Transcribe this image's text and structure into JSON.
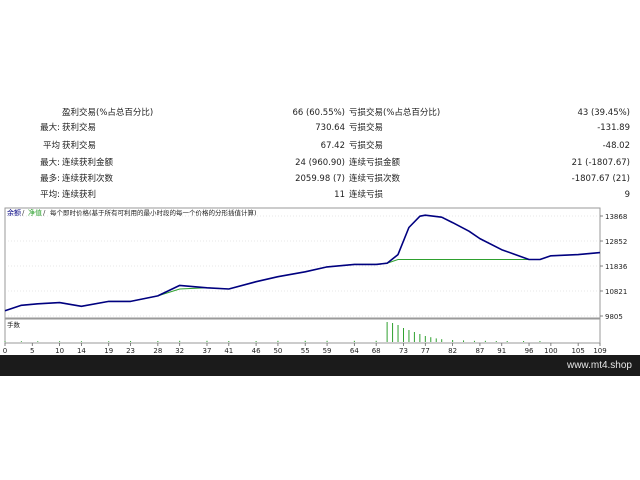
{
  "stats": [
    {
      "label": "",
      "k1": "盈利交易(%占总百分比)",
      "v1": "66 (60.55%)",
      "k2": "亏损交易(%占总百分比)",
      "v2": "43 (39.45%)"
    },
    {
      "label": "最大:",
      "k1": "获利交易",
      "v1": "730.64",
      "k2": "亏损交易",
      "v2": "-131.89"
    },
    {
      "label": "平均",
      "k1": "获利交易",
      "v1": "67.42",
      "k2": "亏损交易",
      "v2": "-48.02"
    },
    {
      "label": "最大:",
      "k1": "连续获利金额",
      "v1": "24 (960.90)",
      "k2": "连续亏损金额",
      "v2": "21 (-1807.67)"
    },
    {
      "label": "最多:",
      "k1": "连续获利次数",
      "v1": "2059.98 (7)",
      "k2": "连续亏损次数",
      "v2": "-1807.67 (21)"
    },
    {
      "label": "平均:",
      "k1": "连续获利",
      "v1": "11",
      "k2": "连续亏损",
      "v2": "9"
    }
  ],
  "chart": {
    "legend": {
      "balance": "余额",
      "equity": "净值",
      "note": "每个即时价格(基于所有可利用的最小时段的每一个价格的分形插值计算)"
    },
    "volume_label": "手数",
    "y_ticks": [
      "13868",
      "12852",
      "11836",
      "10821",
      "9805"
    ],
    "x_ticks": [
      "0",
      "5",
      "10",
      "14",
      "19",
      "23",
      "28",
      "32",
      "37",
      "41",
      "46",
      "50",
      "55",
      "59",
      "64",
      "68",
      "73",
      "77",
      "82",
      "87",
      "91",
      "96",
      "100",
      "105",
      "109"
    ],
    "colors": {
      "balance": "#000080",
      "equity": "#2ea02e",
      "volume": "#2ea02e",
      "grid": "#d0d0d0"
    }
  },
  "chart_data": {
    "type": "line",
    "ylim": [
      9805,
      13868
    ],
    "xlim": [
      0,
      109
    ],
    "series": [
      {
        "name": "余额",
        "x": [
          0,
          3,
          6,
          10,
          14,
          19,
          23,
          28,
          32,
          37,
          41,
          46,
          50,
          55,
          59,
          64,
          68,
          70,
          72,
          74,
          76,
          77,
          80,
          82,
          85,
          87,
          91,
          96,
          98,
          100,
          105,
          109
        ],
        "values": [
          10020,
          10240,
          10300,
          10350,
          10200,
          10400,
          10400,
          10620,
          11050,
          10950,
          10900,
          11200,
          11400,
          11600,
          11800,
          11900,
          11900,
          11950,
          12300,
          13400,
          13860,
          13900,
          13820,
          13600,
          13250,
          12950,
          12500,
          12100,
          12100,
          12250,
          12300,
          12380
        ]
      },
      {
        "name": "净值",
        "x": [
          0,
          3,
          6,
          10,
          14,
          19,
          23,
          28,
          32,
          37,
          41,
          46,
          50,
          55,
          59,
          64,
          68,
          70,
          72,
          98,
          100,
          105,
          109
        ],
        "values": [
          10020,
          10240,
          10300,
          10350,
          10200,
          10400,
          10400,
          10620,
          10900,
          10950,
          10900,
          11200,
          11400,
          11600,
          11800,
          11900,
          11900,
          11950,
          12100,
          12100,
          12250,
          12300,
          12380
        ]
      }
    ]
  },
  "volume_bars": [
    {
      "x": 0,
      "v": 0.04
    },
    {
      "x": 3,
      "v": 0.04
    },
    {
      "x": 6,
      "v": 0.04
    },
    {
      "x": 10,
      "v": 0.04
    },
    {
      "x": 14,
      "v": 0.04
    },
    {
      "x": 19,
      "v": 0.04
    },
    {
      "x": 23,
      "v": 0.05
    },
    {
      "x": 28,
      "v": 0.05
    },
    {
      "x": 32,
      "v": 0.06
    },
    {
      "x": 37,
      "v": 0.06
    },
    {
      "x": 41,
      "v": 0.05
    },
    {
      "x": 46,
      "v": 0.05
    },
    {
      "x": 50,
      "v": 0.06
    },
    {
      "x": 55,
      "v": 0.06
    },
    {
      "x": 59,
      "v": 0.06
    },
    {
      "x": 64,
      "v": 0.06
    },
    {
      "x": 68,
      "v": 0.06
    },
    {
      "x": 70,
      "v": 1.0
    },
    {
      "x": 71,
      "v": 0.95
    },
    {
      "x": 72,
      "v": 0.85
    },
    {
      "x": 73,
      "v": 0.7
    },
    {
      "x": 74,
      "v": 0.6
    },
    {
      "x": 75,
      "v": 0.5
    },
    {
      "x": 76,
      "v": 0.4
    },
    {
      "x": 77,
      "v": 0.3
    },
    {
      "x": 78,
      "v": 0.24
    },
    {
      "x": 79,
      "v": 0.18
    },
    {
      "x": 80,
      "v": 0.14
    },
    {
      "x": 82,
      "v": 0.1
    },
    {
      "x": 84,
      "v": 0.08
    },
    {
      "x": 86,
      "v": 0.06
    },
    {
      "x": 88,
      "v": 0.06
    },
    {
      "x": 90,
      "v": 0.05
    },
    {
      "x": 92,
      "v": 0.05
    },
    {
      "x": 95,
      "v": 0.05
    },
    {
      "x": 98,
      "v": 0.05
    }
  ],
  "footer": {
    "brand": "www.mt4.shop"
  }
}
